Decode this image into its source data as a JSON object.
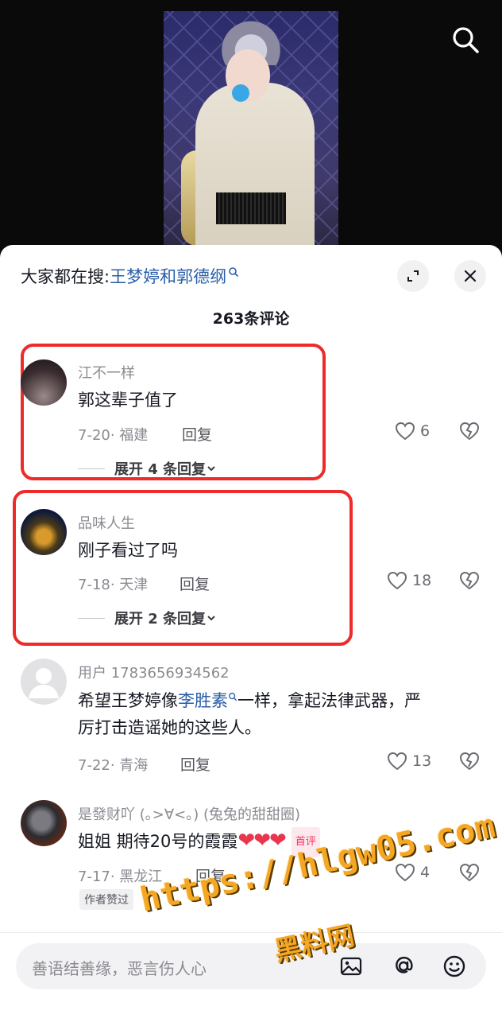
{
  "suggest": {
    "prefix": "大家都在搜:",
    "keyword": "王梦婷和郭德纲"
  },
  "comment_count": "263条评论",
  "comments": [
    {
      "user": "江不一样",
      "text": "郭这辈子值了",
      "date_loc": "7-20· 福建",
      "reply": "回复",
      "likes": "6",
      "expand": "展开 4 条回复"
    },
    {
      "user": "品味人生",
      "text": "刚子看过了吗",
      "date_loc": "7-18· 天津",
      "reply": "回复",
      "likes": "18",
      "expand": "展开 2 条回复"
    },
    {
      "user": "用户 1783656934562",
      "text_before": "希望王梦婷像",
      "text_kw": "李胜素",
      "text_after_line1": "一样，拿起法律武器，严",
      "text_line2": "厉打击造谣她的这些人。",
      "date_loc": "7-22· 青海",
      "reply": "回复",
      "likes": "13"
    },
    {
      "user": "是發财吖 (｡>∀<｡) (兔兔的甜甜圈)",
      "text": "姐姐 期待20号的霞霞",
      "hearts": "❤❤❤",
      "first_badge": "首评",
      "date_loc": "7-17· 黑龙江",
      "reply": "回复",
      "likes": "4",
      "author_badge": "作者赞过"
    }
  ],
  "input": {
    "placeholder": "善语结善缘，恶言伤人心"
  },
  "watermark": {
    "line1": "https://hlgw05.com",
    "line2": "黑料网"
  },
  "colors": {
    "keyword": "#2a5ea8",
    "highlight": "#ee2a2a",
    "watermark": "#f5a623"
  }
}
